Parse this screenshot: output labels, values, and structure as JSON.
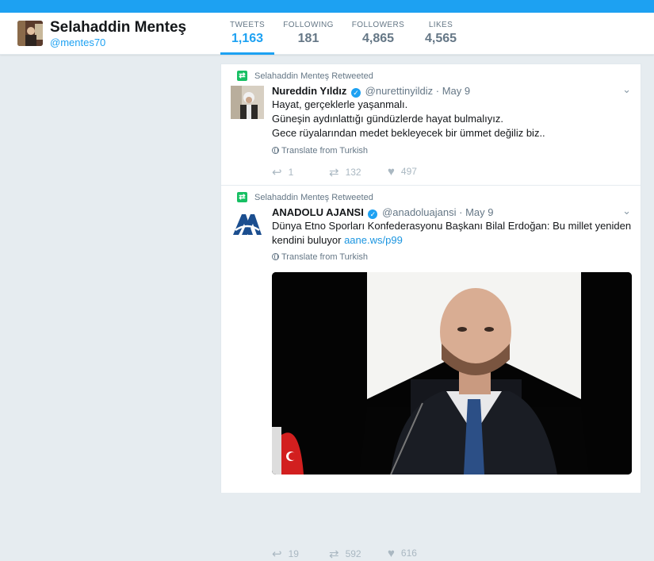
{
  "profile": {
    "name": "Selahaddin Menteş",
    "handle": "@mentes70"
  },
  "stats": [
    {
      "label": "TWEETS",
      "value": "1,163",
      "active": true
    },
    {
      "label": "FOLLOWING",
      "value": "181"
    },
    {
      "label": "FOLLOWERS",
      "value": "4,865"
    },
    {
      "label": "LIKES",
      "value": "4,565"
    }
  ],
  "tweets": [
    {
      "retweeted_by": "Selahaddin Menteş Retweeted",
      "fullname": "Nureddin Yıldız",
      "handle": "@nurettinyildiz",
      "separator": "·",
      "time": "May 9",
      "lines": [
        "Hayat, gerçeklerle yaşanmalı.",
        "Güneşin aydınlattığı gündüzlerde hayat bulmalıyız.",
        "Gece rüyalarından medet bekleyecek bir ümmet değiliz biz.."
      ],
      "translate": "Translate from Turkish",
      "replies": "1",
      "retweets": "132",
      "likes": "497"
    },
    {
      "retweeted_by": "Selahaddin Menteş Retweeted",
      "fullname": "ANADOLU AJANSI",
      "handle": "@anadoluajansi",
      "separator": "·",
      "time": "May 9",
      "text_line1": "Dünya Etno Sporları Konfederasyonu Başkanı Bilal Erdoğan: Bu millet yeniden",
      "text_line2": "kendini buluyor",
      "link": "aane.ws/p99",
      "translate": "Translate from Turkish",
      "replies": "19",
      "retweets": "592",
      "likes": "616"
    }
  ],
  "icons": {
    "retweet_badge": "retweet-icon",
    "verified": "verified-icon",
    "reply": "reply-icon",
    "retweet": "retweet-icon",
    "like": "heart-icon",
    "caret": "chevron-down-icon",
    "globe": "globe-icon"
  },
  "colors": {
    "accent": "#1da1f2",
    "retweet_green": "#17bf63",
    "muted": "#657786"
  }
}
